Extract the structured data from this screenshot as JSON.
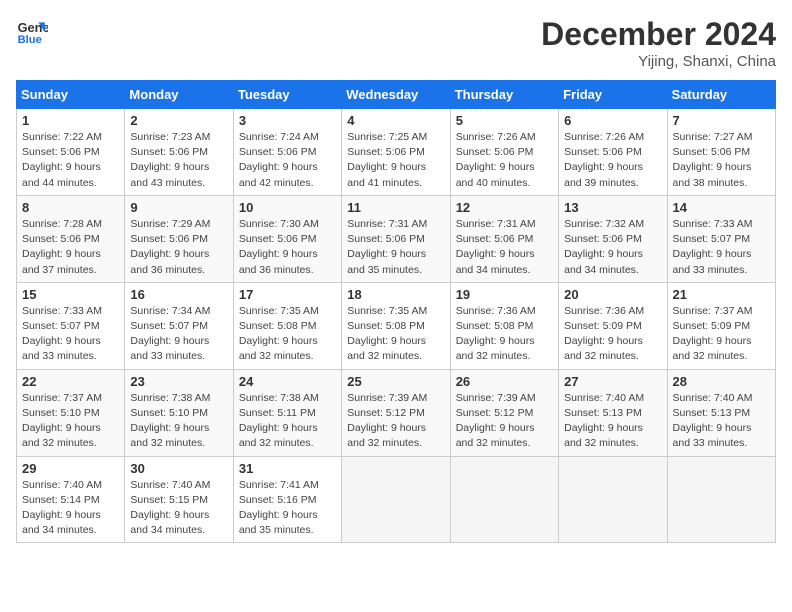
{
  "header": {
    "logo_line1": "General",
    "logo_line2": "Blue",
    "month_year": "December 2024",
    "location": "Yijing, Shanxi, China"
  },
  "weekdays": [
    "Sunday",
    "Monday",
    "Tuesday",
    "Wednesday",
    "Thursday",
    "Friday",
    "Saturday"
  ],
  "weeks": [
    [
      {
        "day": "1",
        "sunrise": "7:22 AM",
        "sunset": "5:06 PM",
        "daylight": "9 hours and 44 minutes."
      },
      {
        "day": "2",
        "sunrise": "7:23 AM",
        "sunset": "5:06 PM",
        "daylight": "9 hours and 43 minutes."
      },
      {
        "day": "3",
        "sunrise": "7:24 AM",
        "sunset": "5:06 PM",
        "daylight": "9 hours and 42 minutes."
      },
      {
        "day": "4",
        "sunrise": "7:25 AM",
        "sunset": "5:06 PM",
        "daylight": "9 hours and 41 minutes."
      },
      {
        "day": "5",
        "sunrise": "7:26 AM",
        "sunset": "5:06 PM",
        "daylight": "9 hours and 40 minutes."
      },
      {
        "day": "6",
        "sunrise": "7:26 AM",
        "sunset": "5:06 PM",
        "daylight": "9 hours and 39 minutes."
      },
      {
        "day": "7",
        "sunrise": "7:27 AM",
        "sunset": "5:06 PM",
        "daylight": "9 hours and 38 minutes."
      }
    ],
    [
      {
        "day": "8",
        "sunrise": "7:28 AM",
        "sunset": "5:06 PM",
        "daylight": "9 hours and 37 minutes."
      },
      {
        "day": "9",
        "sunrise": "7:29 AM",
        "sunset": "5:06 PM",
        "daylight": "9 hours and 36 minutes."
      },
      {
        "day": "10",
        "sunrise": "7:30 AM",
        "sunset": "5:06 PM",
        "daylight": "9 hours and 36 minutes."
      },
      {
        "day": "11",
        "sunrise": "7:31 AM",
        "sunset": "5:06 PM",
        "daylight": "9 hours and 35 minutes."
      },
      {
        "day": "12",
        "sunrise": "7:31 AM",
        "sunset": "5:06 PM",
        "daylight": "9 hours and 34 minutes."
      },
      {
        "day": "13",
        "sunrise": "7:32 AM",
        "sunset": "5:06 PM",
        "daylight": "9 hours and 34 minutes."
      },
      {
        "day": "14",
        "sunrise": "7:33 AM",
        "sunset": "5:07 PM",
        "daylight": "9 hours and 33 minutes."
      }
    ],
    [
      {
        "day": "15",
        "sunrise": "7:33 AM",
        "sunset": "5:07 PM",
        "daylight": "9 hours and 33 minutes."
      },
      {
        "day": "16",
        "sunrise": "7:34 AM",
        "sunset": "5:07 PM",
        "daylight": "9 hours and 33 minutes."
      },
      {
        "day": "17",
        "sunrise": "7:35 AM",
        "sunset": "5:08 PM",
        "daylight": "9 hours and 32 minutes."
      },
      {
        "day": "18",
        "sunrise": "7:35 AM",
        "sunset": "5:08 PM",
        "daylight": "9 hours and 32 minutes."
      },
      {
        "day": "19",
        "sunrise": "7:36 AM",
        "sunset": "5:08 PM",
        "daylight": "9 hours and 32 minutes."
      },
      {
        "day": "20",
        "sunrise": "7:36 AM",
        "sunset": "5:09 PM",
        "daylight": "9 hours and 32 minutes."
      },
      {
        "day": "21",
        "sunrise": "7:37 AM",
        "sunset": "5:09 PM",
        "daylight": "9 hours and 32 minutes."
      }
    ],
    [
      {
        "day": "22",
        "sunrise": "7:37 AM",
        "sunset": "5:10 PM",
        "daylight": "9 hours and 32 minutes."
      },
      {
        "day": "23",
        "sunrise": "7:38 AM",
        "sunset": "5:10 PM",
        "daylight": "9 hours and 32 minutes."
      },
      {
        "day": "24",
        "sunrise": "7:38 AM",
        "sunset": "5:11 PM",
        "daylight": "9 hours and 32 minutes."
      },
      {
        "day": "25",
        "sunrise": "7:39 AM",
        "sunset": "5:12 PM",
        "daylight": "9 hours and 32 minutes."
      },
      {
        "day": "26",
        "sunrise": "7:39 AM",
        "sunset": "5:12 PM",
        "daylight": "9 hours and 32 minutes."
      },
      {
        "day": "27",
        "sunrise": "7:40 AM",
        "sunset": "5:13 PM",
        "daylight": "9 hours and 32 minutes."
      },
      {
        "day": "28",
        "sunrise": "7:40 AM",
        "sunset": "5:13 PM",
        "daylight": "9 hours and 33 minutes."
      }
    ],
    [
      {
        "day": "29",
        "sunrise": "7:40 AM",
        "sunset": "5:14 PM",
        "daylight": "9 hours and 34 minutes."
      },
      {
        "day": "30",
        "sunrise": "7:40 AM",
        "sunset": "5:15 PM",
        "daylight": "9 hours and 34 minutes."
      },
      {
        "day": "31",
        "sunrise": "7:41 AM",
        "sunset": "5:16 PM",
        "daylight": "9 hours and 35 minutes."
      },
      null,
      null,
      null,
      null
    ]
  ]
}
